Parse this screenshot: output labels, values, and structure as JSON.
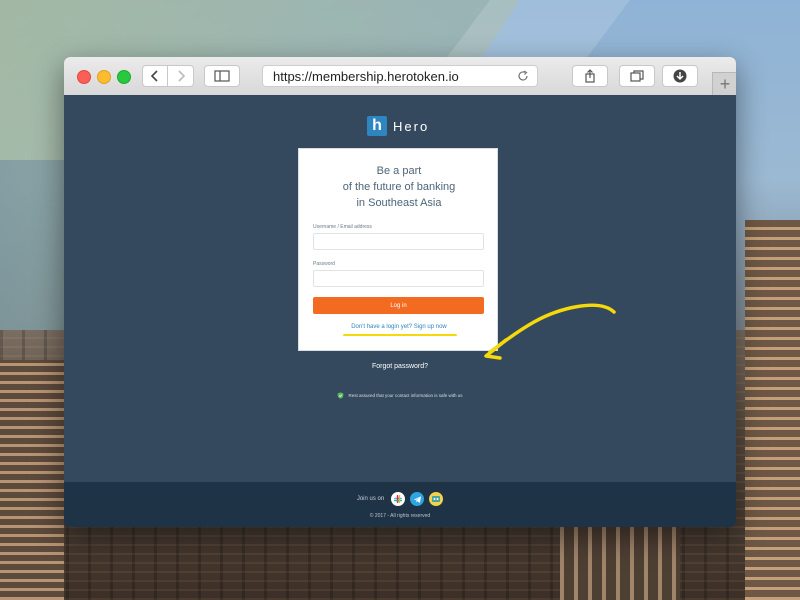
{
  "browser": {
    "url": "https://membership.herotoken.io"
  },
  "logo": {
    "mark": "h",
    "name": "Hero"
  },
  "card": {
    "headline": [
      "Be a part",
      "of the future of banking",
      "in Southeast Asia"
    ],
    "username_label": "Username / Email address",
    "password_label": "Password",
    "login_label": "Log in",
    "signup_text": "Don't have a login yet? Sign up now"
  },
  "forgot_text": "Forgot password?",
  "safe_text": "Rest assured that your contact information is safe with us",
  "footer": {
    "join_text": "Join us on",
    "copyright": "© 2017 - All rights reserved",
    "social_icons": [
      "slack-icon",
      "telegram-icon",
      "group-chat-icon"
    ]
  },
  "colors": {
    "page_bg": "#34495e",
    "footer_bg": "#1f3347",
    "accent": "#f26b21",
    "link": "#2e86c1",
    "highlight": "#f5d90a"
  }
}
